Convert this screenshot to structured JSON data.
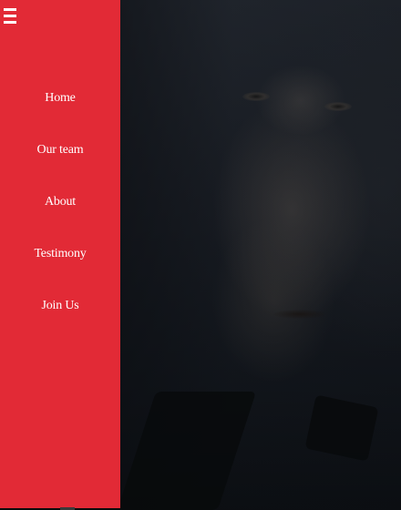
{
  "menu_toggle": {
    "icon": "hamburger-menu-icon"
  },
  "nav": {
    "items": [
      {
        "label": "Home"
      },
      {
        "label": "Our team"
      },
      {
        "label": "About"
      },
      {
        "label": "Testimony"
      },
      {
        "label": "Join Us"
      }
    ]
  },
  "colors": {
    "sidebar": "#e22a36",
    "nav_text": "#ffffff",
    "hero_dark": "#12161c"
  }
}
